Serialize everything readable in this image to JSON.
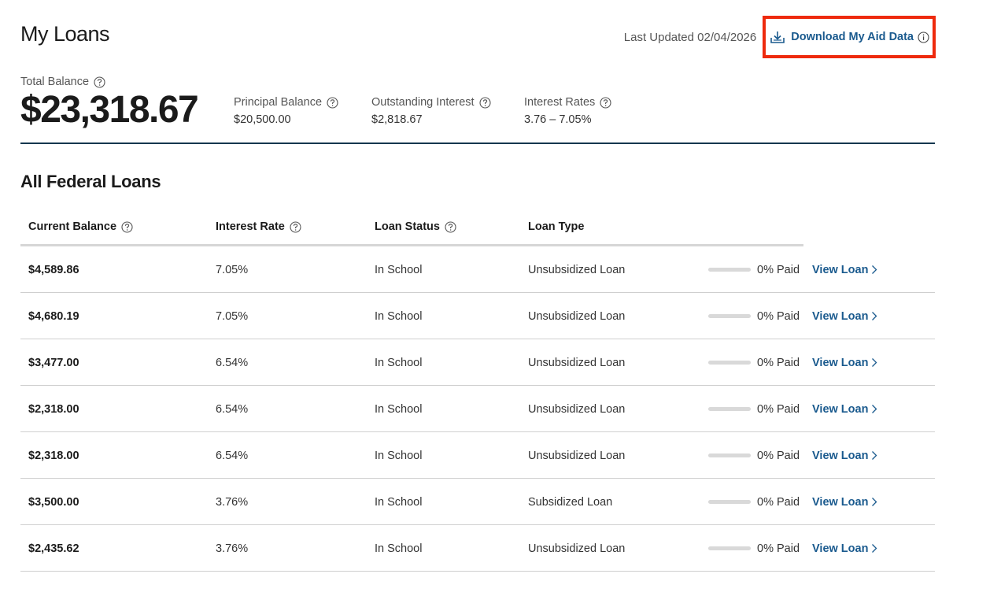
{
  "page": {
    "title": "My Loans"
  },
  "header": {
    "last_updated": "Last Updated 02/04/2026",
    "download_label": "Download My Aid Data"
  },
  "summary": {
    "total_balance_label": "Total Balance",
    "total_balance_value": "$23,318.67",
    "principal_label": "Principal Balance",
    "principal_value": "$20,500.00",
    "interest_label": "Outstanding Interest",
    "interest_value": "$2,818.67",
    "rates_label": "Interest Rates",
    "rates_value": "3.76 – 7.05%"
  },
  "section": {
    "title": "All Federal Loans"
  },
  "table": {
    "headers": [
      "Current Balance",
      "Interest Rate",
      "Loan Status",
      "Loan Type"
    ],
    "view_label": "View Loan",
    "rows": [
      {
        "balance": "$4,589.86",
        "rate": "7.05%",
        "status": "In School",
        "type": "Unsubsidized Loan",
        "paid": "0% Paid",
        "paid_fraction": 0
      },
      {
        "balance": "$4,680.19",
        "rate": "7.05%",
        "status": "In School",
        "type": "Unsubsidized Loan",
        "paid": "0% Paid",
        "paid_fraction": 0
      },
      {
        "balance": "$3,477.00",
        "rate": "6.54%",
        "status": "In School",
        "type": "Unsubsidized Loan",
        "paid": "0% Paid",
        "paid_fraction": 0
      },
      {
        "balance": "$2,318.00",
        "rate": "6.54%",
        "status": "In School",
        "type": "Unsubsidized Loan",
        "paid": "0% Paid",
        "paid_fraction": 0
      },
      {
        "balance": "$2,318.00",
        "rate": "6.54%",
        "status": "In School",
        "type": "Unsubsidized Loan",
        "paid": "0% Paid",
        "paid_fraction": 0
      },
      {
        "balance": "$3,500.00",
        "rate": "3.76%",
        "status": "In School",
        "type": "Subsidized Loan",
        "paid": "0% Paid",
        "paid_fraction": 0
      },
      {
        "balance": "$2,435.62",
        "rate": "3.76%",
        "status": "In School",
        "type": "Unsubsidized Loan",
        "paid": "0% Paid",
        "paid_fraction": 0
      }
    ]
  },
  "colors": {
    "link": "#1a5a8e",
    "highlight": "#ee2a0d",
    "divider": "#14374f"
  },
  "icons": {
    "download": "download-icon",
    "info": "info-icon",
    "help": "help-icon",
    "chevron": "chevron-right-icon"
  }
}
